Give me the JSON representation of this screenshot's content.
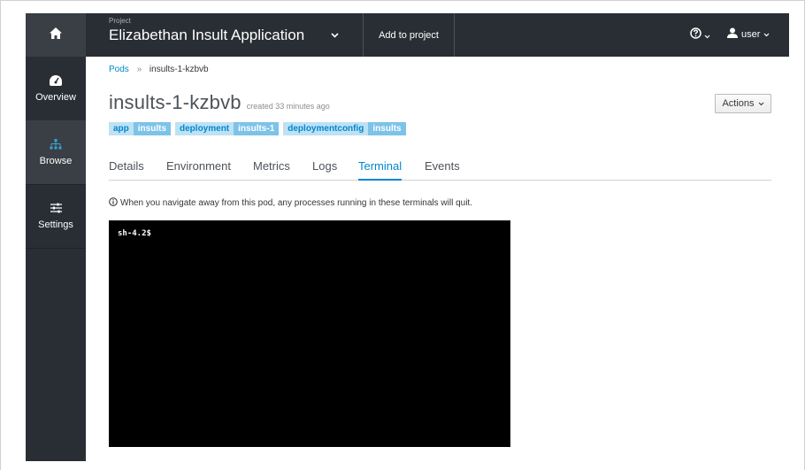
{
  "header": {
    "project_caption": "Project",
    "project_name": "Elizabethan Insult Application",
    "add_to_project": "Add to project",
    "user": "user"
  },
  "sidebar": {
    "items": [
      {
        "label": "Overview",
        "icon": "dashboard-icon"
      },
      {
        "label": "Browse",
        "icon": "sitemap-icon"
      },
      {
        "label": "Settings",
        "icon": "sliders-icon"
      }
    ]
  },
  "breadcrumb": {
    "parent": "Pods",
    "separator": "»",
    "current": "insults-1-kzbvb"
  },
  "pod": {
    "name": "insults-1-kzbvb",
    "created": "created 33 minutes ago",
    "actions_label": "Actions"
  },
  "labels": [
    {
      "key": "app",
      "value": "insults"
    },
    {
      "key": "deployment",
      "value": "insults-1"
    },
    {
      "key": "deploymentconfig",
      "value": "insults"
    }
  ],
  "tabs": [
    "Details",
    "Environment",
    "Metrics",
    "Logs",
    "Terminal",
    "Events"
  ],
  "active_tab": "Terminal",
  "notice": "When you navigate away from this pod, any processes running in these terminals will quit.",
  "terminal": {
    "prompt": "sh-4.2$"
  },
  "colors": {
    "topbar": "#292e34",
    "sidebar_active": "#393f44",
    "link": "#0088ce",
    "label_key_bg": "#bee1f4",
    "label_value_bg": "#7dc3e8"
  }
}
